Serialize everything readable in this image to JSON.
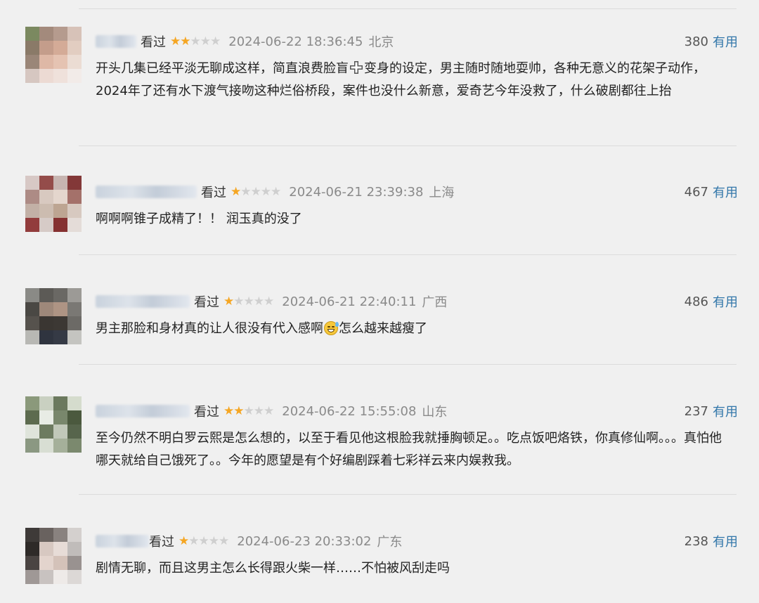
{
  "watched_label": "看过",
  "useful_label": "有用",
  "colors": {
    "accent": "#3377aa",
    "star": "#f5a623",
    "star_empty": "#cfcfcf",
    "meta": "#8a8a8a"
  },
  "comments": [
    {
      "rating": 2,
      "time": "2024-06-22 18:36:45",
      "location": "北京",
      "votes": "380",
      "text_parts": [
        "开头几集已经平淡无聊成这样，简直浪费脸盲",
        "变身的设定，男主随时随地耍帅，各种无意义的花架子动作，2024年了还有水下渡气接吻这种烂俗桥段，案件也没什么新意，爱奇艺今年没救了，什么破剧都往上抬"
      ],
      "inline_icon": "plus-cross-icon"
    },
    {
      "rating": 1,
      "time": "2024-06-21 23:39:38",
      "location": "上海",
      "votes": "467",
      "text_parts": [
        "啊啊啊锥子成精了！！ 润玉真的没了"
      ]
    },
    {
      "rating": 1,
      "time": "2024-06-21 22:40:11",
      "location": "广西",
      "votes": "486",
      "text_parts": [
        "男主那脸和身材真的让人很没有代入感啊",
        "怎么越来越瘦了"
      ],
      "inline_icon": "sweat-smile-emoji-icon"
    },
    {
      "rating": 2,
      "time": "2024-06-22 15:55:08",
      "location": "山东",
      "votes": "237",
      "text_parts": [
        "至今仍然不明白罗云熙是怎么想的，以至于看见他这根脸我就捶胸顿足。。吃点饭吧烙铁，你真修仙啊。。。真怕他哪天就给自己饿死了。。今年的愿望是有个好编剧踩着七彩祥云来内娱救我。"
      ]
    },
    {
      "rating": 1,
      "time": "2024-06-23 20:33:02",
      "location": "广东",
      "votes": "238",
      "text_parts": [
        "剧情无聊，而且这男主怎么长得跟火柴一样……不怕被风刮走吗"
      ]
    }
  ]
}
